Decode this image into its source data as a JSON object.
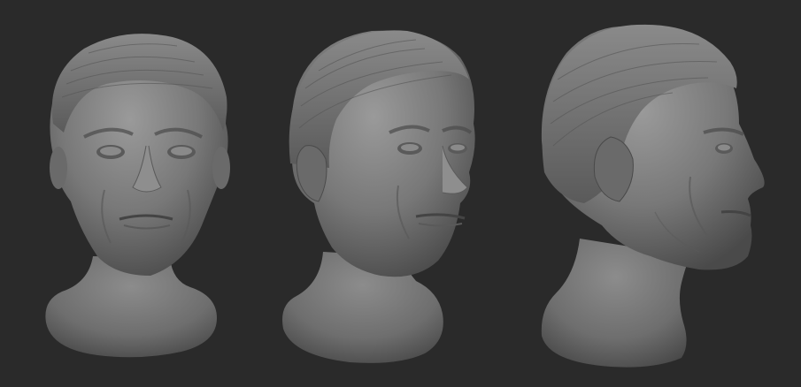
{
  "scene": {
    "background_color": "#2a2a2a",
    "clay_color": "#7a7a7a",
    "views": [
      {
        "view": "front"
      },
      {
        "view": "three-quarter"
      },
      {
        "view": "profile"
      }
    ]
  }
}
